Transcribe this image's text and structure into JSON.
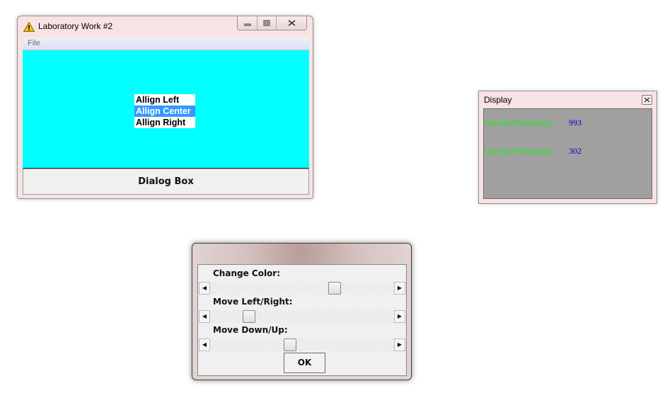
{
  "main_window": {
    "title": "Laboratory Work #2",
    "icon": "warning-icon",
    "controls": {
      "minimize": "▭",
      "restore": "⧉",
      "close": "✕"
    },
    "menu": {
      "file": "File"
    },
    "canvas_color": "#00ffff",
    "list_items": [
      {
        "label": "Allign Left",
        "selected": false
      },
      {
        "label": "Allign Center",
        "selected": true
      },
      {
        "label": "Allign Right",
        "selected": false
      }
    ],
    "dialog_button": "Dialog Box"
  },
  "display_window": {
    "title": "Display",
    "close_glyph": "✕",
    "rows": [
      {
        "label": "Current Position(x):",
        "value": "993"
      },
      {
        "label": "Current Position(y):",
        "value": "302"
      }
    ],
    "label_color": "#00ff00",
    "value_color": "#0000cc"
  },
  "slider_dialog": {
    "sliders": [
      {
        "label": "Change Color:",
        "level": 0.69
      },
      {
        "label": "Move Left/Right:",
        "level": 0.19
      },
      {
        "label": "Move Down/Up:",
        "level": 0.43
      }
    ],
    "arrow_left": "◀",
    "arrow_right": "▶",
    "ok_label": "OK"
  }
}
